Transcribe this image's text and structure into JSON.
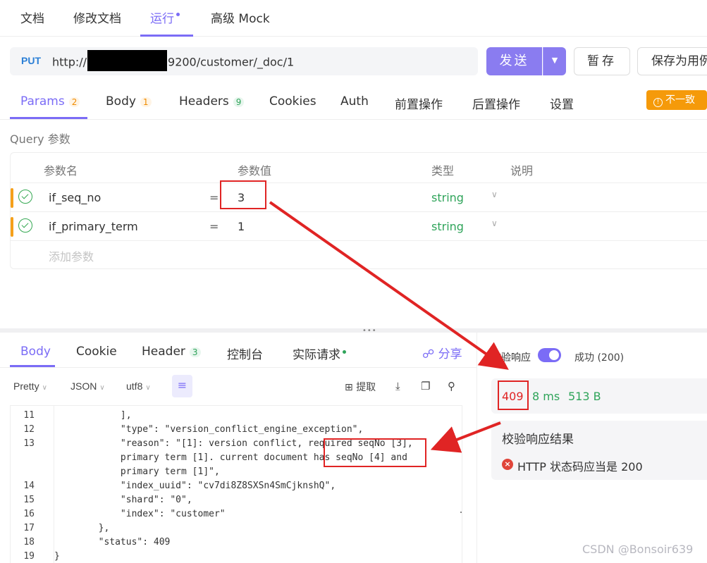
{
  "top_tabs": [
    {
      "label": "文档"
    },
    {
      "label": "修改文档"
    },
    {
      "label": "运行"
    },
    {
      "label": "高级 Mock"
    }
  ],
  "request": {
    "method": "PUT",
    "url_prefix": "http://",
    "url_suffix": "9200/customer/_doc/1",
    "send_label": "发送",
    "stash_label": "暂存",
    "save_as_label": "保存为用例"
  },
  "param_tabs": [
    {
      "label": "Params",
      "count": "2"
    },
    {
      "label": "Body",
      "count": "1"
    },
    {
      "label": "Headers",
      "count": "9"
    },
    {
      "label": "Cookies"
    },
    {
      "label": "Auth"
    },
    {
      "label": "前置操作"
    },
    {
      "label": "后置操作"
    },
    {
      "label": "设置"
    }
  ],
  "mismatch_label": "不一致",
  "query": {
    "title": "Query 参数",
    "headers": [
      "参数名",
      "参数值",
      "类型",
      "说明"
    ],
    "rows": [
      {
        "name": "if_seq_no",
        "eq": "=",
        "value": "3",
        "type": "string"
      },
      {
        "name": "if_primary_term",
        "eq": "=",
        "value": "1",
        "type": "string"
      }
    ],
    "add_placeholder": "添加参数"
  },
  "response_tabs": [
    {
      "label": "Body"
    },
    {
      "label": "Cookie"
    },
    {
      "label": "Header",
      "count": "3"
    },
    {
      "label": "控制台"
    },
    {
      "label": "实际请求"
    }
  ],
  "share_label": "分享",
  "toolbar": {
    "format": "Pretty",
    "lang": "JSON",
    "encoding": "utf8",
    "extract_label": "提取"
  },
  "code_lines": [
    {
      "n": "11",
      "text": "            ],"
    },
    {
      "n": "12",
      "text": "            \"type\": \"version_conflict_engine_exception\","
    },
    {
      "n": "13",
      "text": "            \"reason\": \"[1]: version conflict, required seqNo [3],"
    },
    {
      "n": "",
      "text": "            primary term [1]. current document has seqNo [4] and"
    },
    {
      "n": "",
      "text": "            primary term [1]\","
    },
    {
      "n": "14",
      "text": "            \"index_uuid\": \"cv7di8Z8SXSn4SmCjknshQ\","
    },
    {
      "n": "15",
      "text": "            \"shard\": \"0\","
    },
    {
      "n": "16",
      "text": "            \"index\": \"customer\""
    },
    {
      "n": "17",
      "text": "        },"
    },
    {
      "n": "18",
      "text": "        \"status\": 409"
    },
    {
      "n": "19",
      "text": "}"
    }
  ],
  "verify": {
    "label": "校验响应",
    "success_text": "成功 (200)"
  },
  "metrics": {
    "status": "409",
    "time": "8 ms",
    "size": "513 B"
  },
  "result": {
    "title": "校验响应结果",
    "error": "HTTP 状态码应当是 200"
  },
  "watermark": "CSDN @Bonsoir639",
  "colors": {
    "accent": "#7b6cf6",
    "error": "#e02424",
    "success": "#2fa45a",
    "warning": "#f59a0a"
  }
}
